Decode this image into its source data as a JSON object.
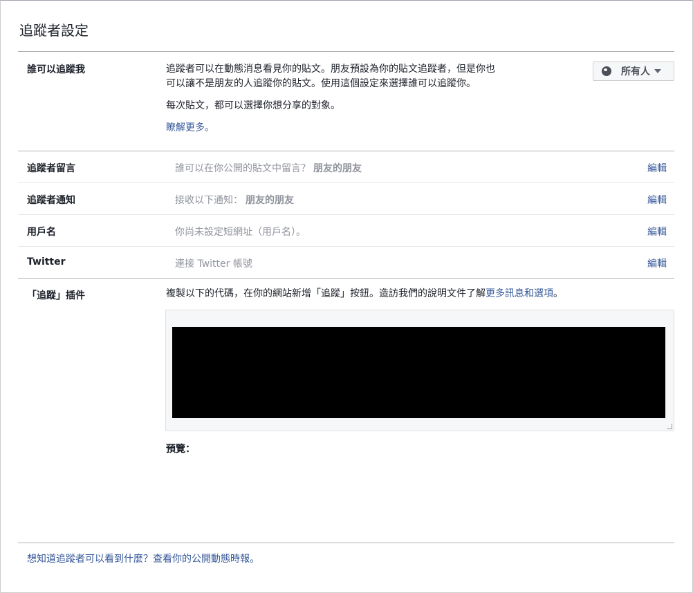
{
  "title": "追蹤者設定",
  "who_can_follow": {
    "label": "誰可以追蹤我",
    "desc_line1": "追蹤者可以在動態消息看見你的貼文。朋友預設為你的貼文追蹤者，但是你也",
    "desc_line2": "可以讓不是朋友的人追蹤你的貼文。使用這個設定來選擇誰可以追蹤你。",
    "desc2": "每次貼文，都可以選擇你想分享的對象。",
    "learn_more": "瞭解更多。",
    "audience": "所有人",
    "audience_icon": "globe-icon"
  },
  "rows": [
    {
      "label": "追蹤者留言",
      "desc": "誰可以在你公開的貼文中留言？",
      "value": "朋友的朋友",
      "edit": "編輯"
    },
    {
      "label": "追蹤者通知",
      "desc": "接收以下通知：",
      "value": "朋友的朋友",
      "edit": "編輯"
    },
    {
      "label": "用戶名",
      "desc": "你尚未設定短網址（用戶名）。",
      "value": "",
      "edit": "編輯"
    },
    {
      "label": "Twitter",
      "desc": "連接 Twitter 帳號",
      "value": "",
      "edit": "編輯"
    }
  ],
  "plugin": {
    "label": "「追蹤」插件",
    "desc": "複製以下的代碼，在你的網站新增「追蹤」按鈕。造訪我們的說明文件了解",
    "link": "更多訊息和選項",
    "period": "。",
    "preview_label": "預覽："
  },
  "footer": {
    "link": "想知道追蹤者可以看到什麼？查看你的公開動態時報。"
  }
}
